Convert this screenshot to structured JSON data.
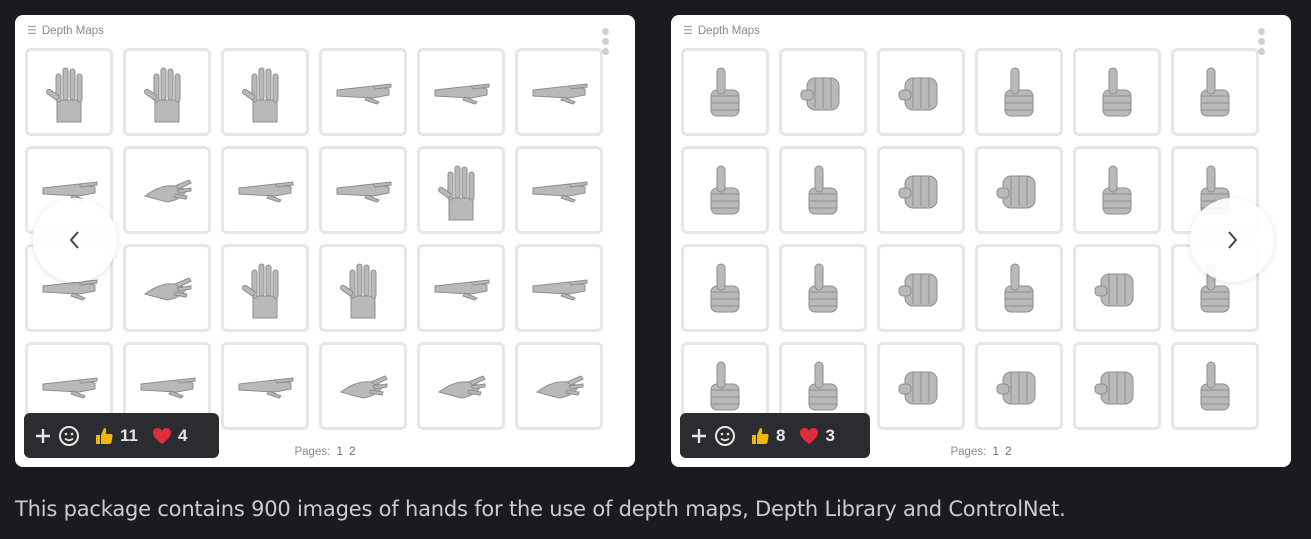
{
  "panels": [
    {
      "title": "Depth Maps",
      "pages_label": "Pages:",
      "pages": [
        "1",
        "2"
      ],
      "tiles": [
        "open-palm",
        "open-palm",
        "open-palm",
        "flat-hand",
        "flat-hand",
        "flat-hand",
        "flat-hand",
        "relaxed-hand",
        "flat-hand",
        "flat-hand",
        "open-palm",
        "flat-hand",
        "flat-hand",
        "relaxed-hand",
        "open-palm",
        "open-palm",
        "flat-hand",
        "flat-hand",
        "flat-hand",
        "flat-hand",
        "flat-hand",
        "relaxed-hand",
        "relaxed-hand",
        "relaxed-hand"
      ]
    },
    {
      "title": "Depth Maps",
      "pages_label": "Pages:",
      "pages": [
        "1",
        "2"
      ],
      "tiles": [
        "thumbs-up",
        "fist",
        "fist",
        "thumbs-up",
        "thumbs-up",
        "thumbs-up",
        "thumbs-up",
        "thumbs-up",
        "fist",
        "fist",
        "thumbs-up",
        "thumbs-up",
        "thumbs-up",
        "thumbs-up",
        "fist",
        "thumbs-up",
        "fist",
        "thumbs-up",
        "thumbs-up",
        "thumbs-up",
        "fist",
        "fist",
        "fist",
        "thumbs-up"
      ]
    }
  ],
  "reactions": [
    {
      "like_count": "11",
      "heart_count": "4"
    },
    {
      "like_count": "8",
      "heart_count": "3"
    }
  ],
  "nav": {
    "prev_icon": "chevron-left-icon",
    "next_icon": "chevron-right-icon"
  },
  "description": "This package contains 900 images of hands for the use of depth maps, Depth Library and ControlNet.",
  "colors": {
    "background": "#1a1b1e",
    "card": "#ffffff",
    "reaction_bar": "#2b2c30",
    "heart": "#e02d3c",
    "thumb": "#f2b705",
    "text": "#c9cdd3"
  }
}
